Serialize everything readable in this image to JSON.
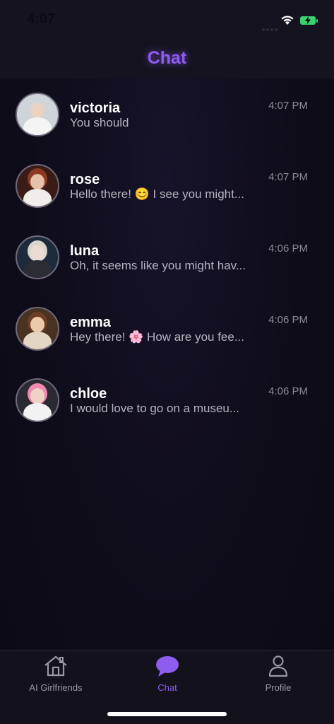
{
  "status_bar": {
    "time": "4:07",
    "icons": [
      "signal-dots-icon",
      "wifi-icon",
      "battery-charging-icon"
    ],
    "battery_color": "#3bd16f"
  },
  "header": {
    "title": "Chat",
    "title_color": "#8f5cf0"
  },
  "chats": [
    {
      "name": "victoria",
      "preview": "You should",
      "time": "4:07 PM",
      "avatar": "victoria-avatar"
    },
    {
      "name": "rose",
      "preview": "Hello there! 😊 I see you might...",
      "time": "4:07 PM",
      "avatar": "rose-avatar"
    },
    {
      "name": "luna",
      "preview": "Oh, it seems like you might hav...",
      "time": "4:06 PM",
      "avatar": "luna-avatar"
    },
    {
      "name": "emma",
      "preview": "Hey there! 🌸 How are you fee...",
      "time": "4:06 PM",
      "avatar": "emma-avatar"
    },
    {
      "name": "chloe",
      "preview": "I would love to go on a museu...",
      "time": "4:06 PM",
      "avatar": "chloe-avatar"
    }
  ],
  "tab_bar": {
    "tabs": [
      {
        "label": "AI Girlfriends",
        "icon": "home-icon",
        "active": false
      },
      {
        "label": "Chat",
        "icon": "chat-bubble-icon",
        "active": true
      },
      {
        "label": "Profile",
        "icon": "person-icon",
        "active": false
      }
    ],
    "active_color": "#8f5cf0"
  }
}
